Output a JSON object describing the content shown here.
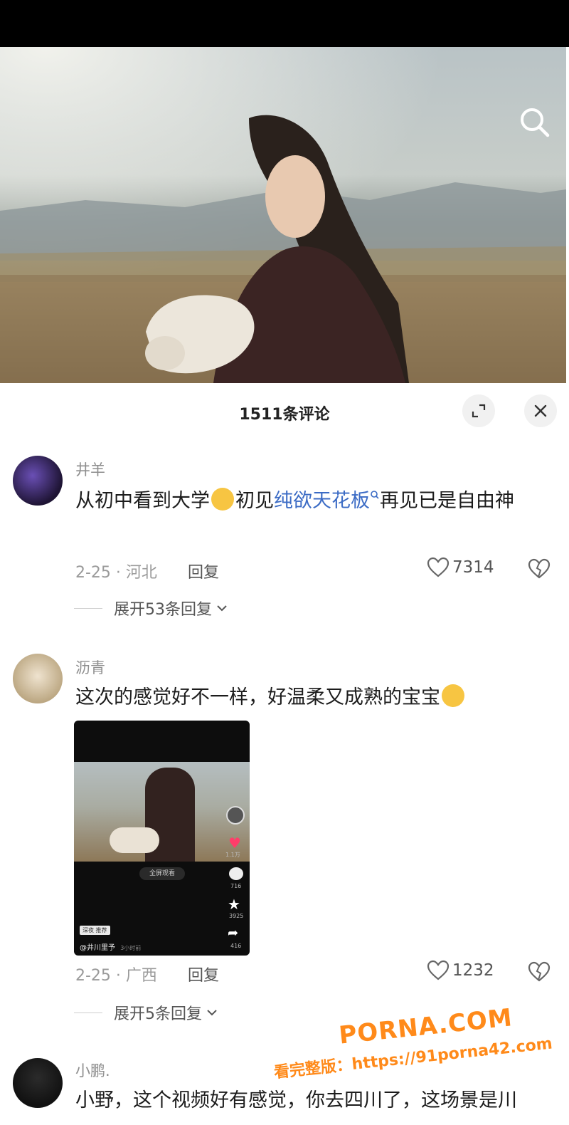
{
  "topbar": {
    "title": "",
    "right_glyph": ""
  },
  "comments_header": {
    "title": "1511条评论"
  },
  "icons": {
    "search": "search-icon",
    "expand": "expand-icon",
    "close": "close-icon",
    "like": "heart-outline-icon",
    "dislike": "broken-heart-icon",
    "chevron": "chevron-down-icon"
  },
  "colors": {
    "link": "#3b6bc5",
    "watermark": "#ff8a1a"
  },
  "comments": [
    {
      "user": "井羊",
      "text_before": "从初中看到大学",
      "text_mid": "初见",
      "link_text": "纯欲天花板",
      "text_after": "再见已是自由神",
      "date_location": "2-25 · 河北",
      "reply_label": "回复",
      "likes": "7314",
      "expand_label": "展开53条回复"
    },
    {
      "user": "沥青",
      "text": "这次的感觉好不一样，好温柔又成熟的宝宝",
      "date_location": "2-25 · 广西",
      "reply_label": "回复",
      "likes": "1232",
      "expand_label": "展开5条回复",
      "embedded": {
        "center_button": "全屏观看",
        "like_count": "1.1万",
        "comment_count": "716",
        "star_count": "3925",
        "share_count": "416",
        "author": "@井川里予",
        "time": "3小时前",
        "tag": "深夜 推荐"
      }
    },
    {
      "user": "小鹏.",
      "text": "小野，这个视频好有感觉，你去四川了，这场景是川"
    }
  ],
  "watermark": {
    "line1": "PORNA.COM",
    "line2": "看完整版：https://91porna42.com"
  }
}
